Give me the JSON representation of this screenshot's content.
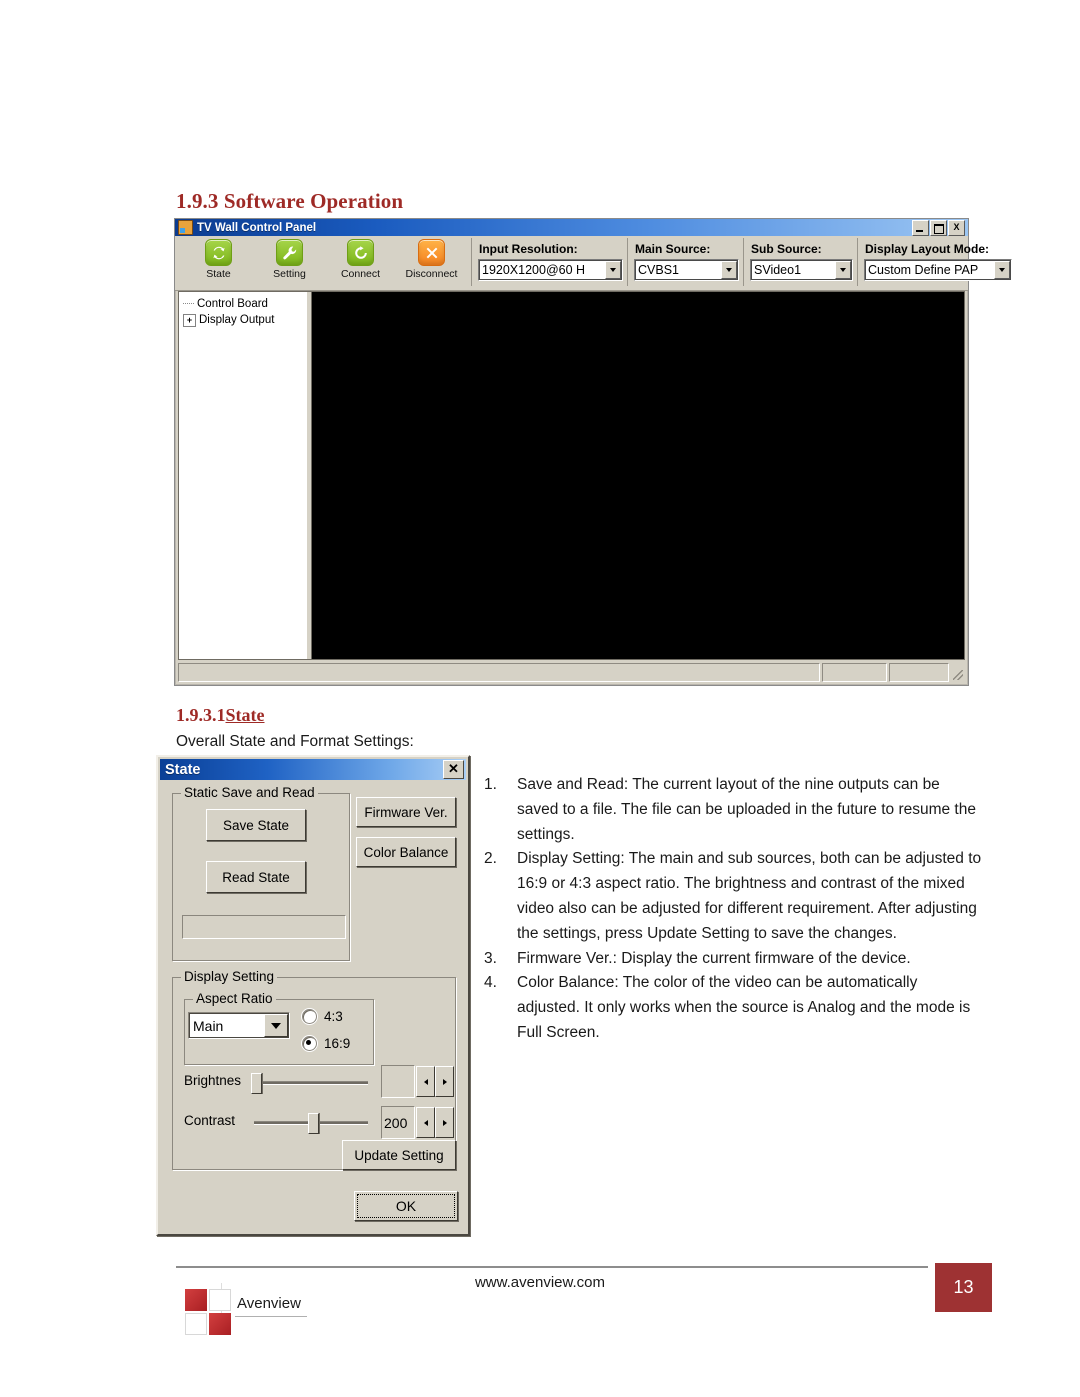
{
  "doc": {
    "section_heading": "1.9.3 Software Operation",
    "sub_heading_num": "1.9.3.1",
    "sub_heading_word": "State",
    "caption": "Overall State and Format Settings:"
  },
  "app_window": {
    "title": "TV Wall Control Panel",
    "title_icon": "application-icon",
    "window_buttons": {
      "minimize": "minimize-icon",
      "maximize": "maximize-icon",
      "close": "X"
    },
    "toolbar_buttons": [
      {
        "label": "State",
        "icon": "refresh-icon",
        "color": "#8bc220"
      },
      {
        "label": "Setting",
        "icon": "wrench-icon",
        "color": "#8bc220"
      },
      {
        "label": "Connect",
        "icon": "connect-icon",
        "color": "#8bc220"
      },
      {
        "label": "Disconnect",
        "icon": "close-x-icon",
        "color": "#f58220"
      }
    ],
    "fields": [
      {
        "label": "Input Resolution:",
        "value": "1920X1200@60 H"
      },
      {
        "label": "Main Source:",
        "value": "CVBS1"
      },
      {
        "label": "Sub Source:",
        "value": "SVideo1"
      },
      {
        "label": "Display Layout Mode:",
        "value": "Custom Define PAP"
      }
    ],
    "tree": [
      {
        "label": "Control Board",
        "expander": ""
      },
      {
        "label": "Display Output",
        "expander": "+"
      }
    ],
    "canvas_color": "#000000"
  },
  "state_dialog": {
    "title": "State",
    "close_label": "✕",
    "static_group": {
      "title": "Static Save and Read",
      "save_button": "Save State",
      "read_button": "Read State",
      "status_field_value": ""
    },
    "firmware_button": "Firmware Ver.",
    "color_balance_button": "Color Balance",
    "display_group": {
      "title": "Display Setting",
      "aspect_group_title": "Aspect Ratio",
      "target_select": "Main",
      "radio_43": "4:3",
      "radio_169": "16:9",
      "selected_ratio": "16:9",
      "brightness_label": "Brightnes",
      "brightness_value": "",
      "contrast_label": "Contrast",
      "contrast_value": "200",
      "update_button": "Update Setting"
    },
    "ok_button": "OK"
  },
  "notes": [
    {
      "num": "1.",
      "text": "Save and Read: The current layout of the nine outputs can be saved to a file. The file can be uploaded in the future to resume the settings."
    },
    {
      "num": "2.",
      "text": "Display Setting: The main and sub sources, both can be adjusted to 16:9 or 4:3 aspect ratio. The brightness and contrast of the mixed video also can be adjusted for different requirement. After adjusting the settings, press Update Setting to save the changes."
    },
    {
      "num": "3.",
      "text": "Firmware Ver.: Display the current firmware of the device."
    },
    {
      "num": "4.",
      "text": "Color Balance: The color of the video can be automatically adjusted. It only works when the source is Analog and the mode is Full Screen."
    }
  ],
  "footer": {
    "website": "www.avenview.com",
    "page_number": "13",
    "brand": "Avenview",
    "brand_color": "#9e3233"
  }
}
